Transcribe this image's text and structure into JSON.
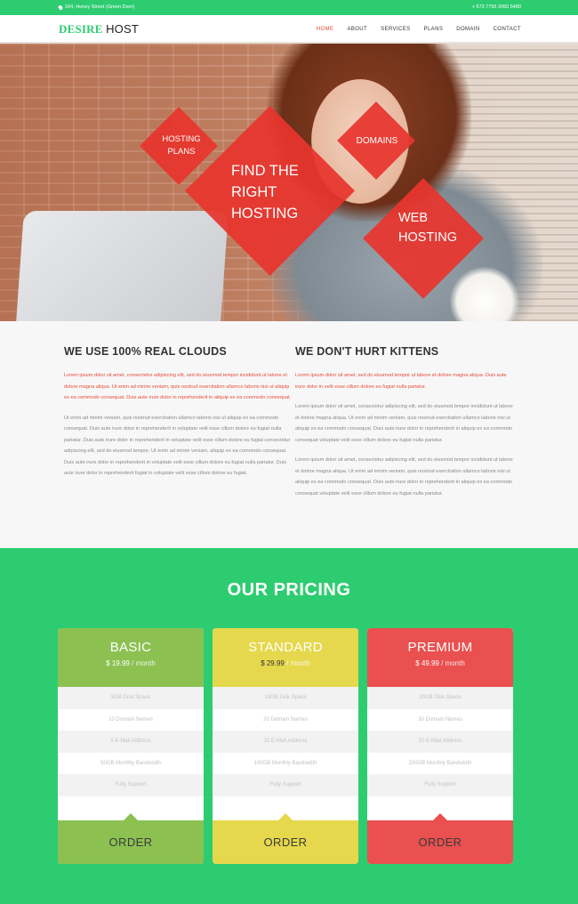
{
  "topbar": {
    "address": "164, Honey Street (Green Door)",
    "phone": "+ 673 7756 2060 5480"
  },
  "brand": {
    "part1": "DESIRE",
    "part2": "HOST"
  },
  "nav": {
    "items": [
      "HOME",
      "ABOUT",
      "SERVICES",
      "PLANS",
      "DOMAIN",
      "CONTACT"
    ],
    "active": "HOME"
  },
  "hero": {
    "diamond_hosting_plans": "HOSTING PLANS",
    "diamond_main": "FIND THE RIGHT HOSTING",
    "diamond_domains": "DOMAINS",
    "diamond_web_hosting": "WEB HOSTING"
  },
  "features": {
    "left": {
      "title": "WE USE 100% REAL CLOUDS",
      "p1": "Lorem ipsum dolor sit amet, consectetur adipiscing elit, sed do eiusmod tempor incididunt ut labore et dolore magna aliqua. Ut enim ad minim veniam, quis nostrud exercitation ullamco laboris nisi ut aliquip ex ea commodo consequat. Duis aute irure dolor in reprehenderit in aliquip ex ea commodo consequat.",
      "p2": "Ut enim ad minim veniam, quis nostrud exercitation ullamco laboris nisi ut aliquip ex ea commodo consequat. Duis aute irure dolor in reprehenderit in voluptate velit esse cillum dolore eu fugiat nulla pariatur. Duis aute irure dolor in reprehenderit in voluptate velit esse cillum dolore eu fugiat consectetur adipiscing elit, sed do eiusmod tempor. Ut enim ad minim veniam, aliquip ex ea commodo consequat. Duis aute irure dolor in reprehenderit in voluptate velit esse cillum dolore eu fugiat nulla pariatur. Duis aute irure dolor in reprehenderit fugiat in voluptate velit esse cillum dolore eu fugiat."
    },
    "right": {
      "title": "WE DON'T HURT KITTENS",
      "p1": "Lorem ipsum dolor sit amet, sed do eiusmod tempor ut labore et dolore magna aliqua. Duis aute irure dolor in velit esse cillum dolore eu fugiat nulla pariatur.",
      "p2": "Lorem ipsum dolor sit amet, consectetur adipiscing elit, sed do eiusmod tempor incididunt ut labore et dolore magna aliqua. Ut enim ad minim veniam, quis nostrud exercitation ullamco laboris nisi ut aliquip ex ea commodo consequat. Duis aute irure dolor in reprehenderit in aliquip ex ea commodo consequat voluptate velit esse cillum dolore eu fugiat nulla pariatur.",
      "p3": "Lorem ipsum dolor sit amet, consectetur adipiscing elit, sed do eiusmod tempor incididunt ut labore et dolore magna aliqua. Ut enim ad minim veniam, quis nostrud exercitation ullamco laboris nisi ut aliquip ex ea commodo consequat. Duis aute irure dolor in reprehenderit in aliquip ex ea commodo consequat voluptate velit esse cillum dolore eu fugiat nulla pariatur."
    }
  },
  "pricing": {
    "title": "OUR PRICING",
    "plans": [
      {
        "name": "BASIC",
        "price": "$ 19.99",
        "period": "/ month",
        "features": [
          "5GB Disk Space",
          "10 Domain Names",
          "5 E-Mail Address",
          "50GB Monthly Bandwidth",
          "Fully Support"
        ],
        "order": "ORDER",
        "head_color": "#8cc152",
        "foot_color": "#8cc152"
      },
      {
        "name": "STANDARD",
        "price": "$ 29.99",
        "period": "/ month",
        "features": [
          "10GB Disk Space",
          "20 Domain Names",
          "10 E-Mail Address",
          "100GB Monthly Bandwidth",
          "Fully Support"
        ],
        "order": "ORDER",
        "head_color": "#e5d84c",
        "foot_color": "#e5d84c"
      },
      {
        "name": "PREMIUM",
        "price": "$ 49.99",
        "period": "/ month",
        "features": [
          "20GB Disk Space",
          "30 Domain Names",
          "20 E-Mail Address",
          "200GB Monthly Bandwidth",
          "Fully Support"
        ],
        "order": "ORDER",
        "head_color": "#e9504f",
        "foot_color": "#e9504f"
      }
    ]
  }
}
